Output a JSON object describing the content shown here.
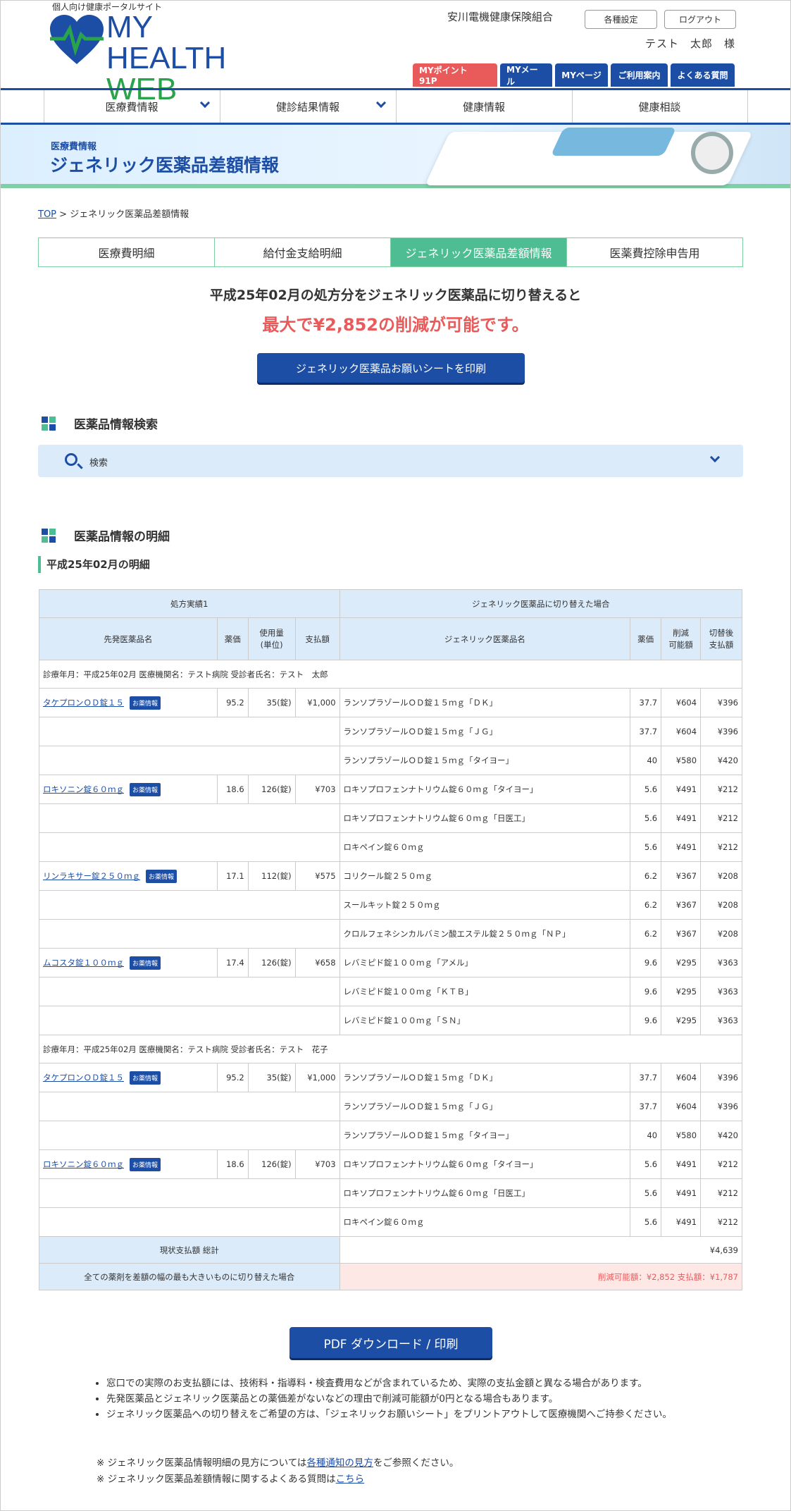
{
  "header": {
    "site_sub": "個人向け健康ポータルサイト",
    "logo_line1": "MY HEALTH",
    "logo_line2": "WEB",
    "org": "安川電機健康保険組合",
    "settings": "各種設定",
    "logout": "ログアウト",
    "user": "テスト　太郎　様"
  },
  "topnav": [
    "MYポイント　91P",
    "MYメール",
    "MYページ",
    "ご利用案内",
    "よくある質問"
  ],
  "gnav": [
    "医療費情報",
    "健診結果情報",
    "健康情報",
    "健康相談"
  ],
  "banner": {
    "sub": "医療費情報",
    "title": "ジェネリック医薬品差額情報"
  },
  "breadcrumb": {
    "top": "TOP",
    "sep": " > ",
    "current": "ジェネリック医薬品差額情報"
  },
  "tabs": [
    "医療費明細",
    "給付金支給明細",
    "ジェネリック医薬品差額情報",
    "医薬費控除申告用"
  ],
  "lead": {
    "line1": "平成25年02月の処方分をジェネリック医薬品に切り替えると",
    "line2": "最大で¥2,852の削減が可能です。"
  },
  "print_sheet": "ジェネリック医薬品お願いシートを印刷",
  "search_section": {
    "title": "医薬品情報検索",
    "label": "検索"
  },
  "detail_section": {
    "title": "医薬品情報の明細",
    "period": "平成25年02月の明細"
  },
  "table": {
    "group_left": "処方実績1",
    "group_right": "ジェネリック医薬品に切り替えた場合",
    "cols": [
      "先発医薬品名",
      "薬価",
      "使用量\n(単位)",
      "支払額",
      "ジェネリック医薬品名",
      "薬価",
      "削減\n可能額",
      "切替後\n支払額"
    ],
    "badge": "お薬情報",
    "patient1": "診療年月：平成25年02月 医療機関名：テスト病院 受診者氏名：テスト　太郎",
    "patient2": "診療年月：平成25年02月 医療機関名：テスト病院 受診者氏名：テスト　花子",
    "total_label": "現状支払額 総計",
    "total_value": "¥4,639",
    "switch_label": "全ての薬剤を差額の幅の最も大きいものに切り替えた場合",
    "switch_value": "削減可能額：¥2,852 支払額：¥1,787"
  },
  "pdf_button": "PDF ダウンロード / 印刷",
  "notes": [
    "窓口での実際のお支払額には、技術料・指導料・検査費用などが含まれているため、実際の支払金額と異なる場合があります。",
    "先発医薬品とジェネリック医薬品との薬価差がないなどの理由で削減可能額が0円となる場合もあります。",
    "ジェネリック医薬品への切り替えをご希望の方は、「ジェネリックお願いシート」をプリントアウトして医療機関へご持参ください。"
  ],
  "footer": {
    "f1_pre": "※ ジェネリック医薬品情報明細の見方については",
    "f1_link": "各種通知の見方",
    "f1_post": "をご参照ください。",
    "f2_pre": "※ ジェネリック医薬品差額情報に関するよくある質問は",
    "f2_link": "こちら"
  },
  "colors": {
    "brand": "#1d4ea6",
    "accent_green": "#4fbd93",
    "alert": "#e95b5b"
  }
}
